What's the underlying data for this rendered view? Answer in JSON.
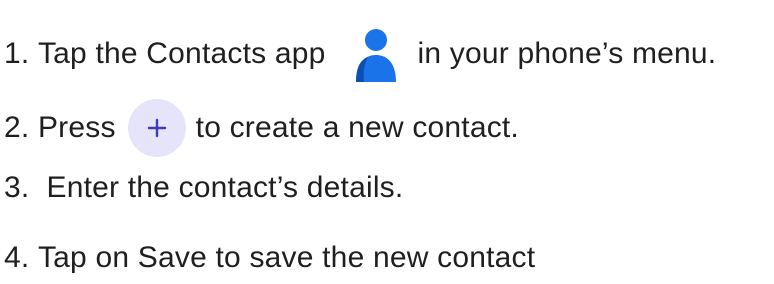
{
  "steps": [
    {
      "number": "1.",
      "before": "Tap the Contacts app",
      "after": "in your phone’s menu.",
      "icon": "contacts-app-icon"
    },
    {
      "number": "2.",
      "before": "Press",
      "after": "to create a new contact.",
      "icon": "plus-icon"
    },
    {
      "number": "3.",
      "text": "Enter the contact’s details."
    },
    {
      "number": "4.",
      "text": "Tap on Save to save the new contact"
    }
  ],
  "colors": {
    "contacts_icon_primary": "#1a73e8",
    "contacts_icon_shadow": "#0b4fb3",
    "plus_button_bg": "#e6e4fb",
    "plus_symbol": "#3b3bb5",
    "text": "#1f1f1f"
  }
}
